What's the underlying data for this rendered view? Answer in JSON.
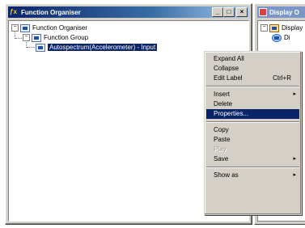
{
  "left_window": {
    "title": "Function Organiser",
    "buttons": {
      "minimize": "_",
      "maximize": "□",
      "close": "×"
    }
  },
  "tree": {
    "root": {
      "label": "Function Organiser",
      "expander": "−"
    },
    "group": {
      "label": "Function Group",
      "expander": "−"
    },
    "item": {
      "label": "Autospectrum(Accelerometer) - Input"
    }
  },
  "right_window": {
    "title": "Display O",
    "tree": {
      "root_label": "Display",
      "child_label": "Di"
    }
  },
  "context_menu": {
    "items": [
      {
        "label": "Expand All"
      },
      {
        "label": "Collapse"
      },
      {
        "label": "Edit Label",
        "shortcut": "Ctrl+R"
      },
      {
        "separator": true
      },
      {
        "label": "Insert",
        "submenu": true
      },
      {
        "label": "Delete"
      },
      {
        "label": "Properties...",
        "highlighted": true
      },
      {
        "separator": true
      },
      {
        "label": "Copy"
      },
      {
        "label": "Paste"
      },
      {
        "label": "Play",
        "disabled": true
      },
      {
        "label": "Save",
        "submenu": true
      },
      {
        "separator": true
      },
      {
        "label": "Show as",
        "submenu": true
      }
    ],
    "submenu_arrow": "▸"
  }
}
